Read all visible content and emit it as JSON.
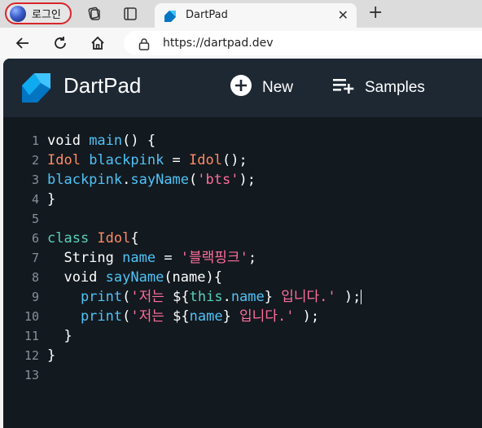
{
  "browser": {
    "profile_label": "로그인",
    "tab_title": "DartPad",
    "url": "https://dartpad.dev"
  },
  "app": {
    "title": "DartPad",
    "new_label": "New",
    "samples_label": "Samples"
  },
  "editor": {
    "line_numbers": [
      "1",
      "2",
      "3",
      "4",
      "5",
      "6",
      "7",
      "8",
      "9",
      "10",
      "11",
      "12",
      "13"
    ],
    "lines": [
      [
        {
          "t": "void ",
          "c": "kw"
        },
        {
          "t": "main",
          "c": "fn"
        },
        {
          "t": "() {",
          "c": "plain"
        }
      ],
      [
        {
          "t": "Idol ",
          "c": "cls"
        },
        {
          "t": "blackpink",
          "c": "fn"
        },
        {
          "t": " = ",
          "c": "plain"
        },
        {
          "t": "Idol",
          "c": "cls"
        },
        {
          "t": "();",
          "c": "plain"
        }
      ],
      [
        {
          "t": "blackpink",
          "c": "fn"
        },
        {
          "t": ".",
          "c": "plain"
        },
        {
          "t": "sayName",
          "c": "fn"
        },
        {
          "t": "(",
          "c": "plain"
        },
        {
          "t": "'bts'",
          "c": "str"
        },
        {
          "t": ");",
          "c": "plain"
        }
      ],
      [
        {
          "t": "}",
          "c": "plain"
        }
      ],
      [],
      [
        {
          "t": "class ",
          "c": "kw2"
        },
        {
          "t": "Idol",
          "c": "cls"
        },
        {
          "t": "{",
          "c": "plain"
        }
      ],
      [
        {
          "t": "  String ",
          "c": "plain"
        },
        {
          "t": "name",
          "c": "fn"
        },
        {
          "t": " = ",
          "c": "plain"
        },
        {
          "t": "'블랙핑크'",
          "c": "str"
        },
        {
          "t": ";",
          "c": "plain"
        }
      ],
      [
        {
          "t": "  void ",
          "c": "plain"
        },
        {
          "t": "sayName",
          "c": "fn"
        },
        {
          "t": "(name){",
          "c": "plain"
        }
      ],
      [
        {
          "t": "    print",
          "c": "fn"
        },
        {
          "t": "(",
          "c": "plain"
        },
        {
          "t": "'저는 ",
          "c": "str"
        },
        {
          "t": "${",
          "c": "plain"
        },
        {
          "t": "this",
          "c": "kw2"
        },
        {
          "t": ".",
          "c": "plain"
        },
        {
          "t": "name",
          "c": "fn"
        },
        {
          "t": "}",
          "c": "plain"
        },
        {
          "t": " 입니다.'",
          "c": "str"
        },
        {
          "t": " );",
          "c": "plain"
        },
        {
          "t": "",
          "c": "cursor"
        }
      ],
      [
        {
          "t": "    print",
          "c": "fn"
        },
        {
          "t": "(",
          "c": "plain"
        },
        {
          "t": "'저는 ",
          "c": "str"
        },
        {
          "t": "${",
          "c": "plain"
        },
        {
          "t": "name",
          "c": "fn"
        },
        {
          "t": "}",
          "c": "plain"
        },
        {
          "t": " 입니다.'",
          "c": "str"
        },
        {
          "t": " );",
          "c": "plain"
        }
      ],
      [
        {
          "t": "  }",
          "c": "plain"
        }
      ],
      [
        {
          "t": "}",
          "c": "plain"
        }
      ],
      []
    ]
  },
  "icons": {
    "collections": "collections-icon",
    "tab_actions": "tab-actions-icon",
    "favicon": "dart-favicon-icon",
    "close": "close-icon",
    "new_tab": "plus-icon",
    "back": "back-arrow-icon",
    "refresh": "refresh-icon",
    "home": "home-icon",
    "lock": "lock-icon",
    "add": "add-circle-icon",
    "samples": "playlist-add-icon"
  },
  "colors": {
    "header_bg": "#1d2833",
    "editor_bg": "#12191f",
    "function": "#4fc3f7",
    "class": "#ff8a65",
    "string": "#ff6e9a",
    "keyword": "#5ad1b8"
  }
}
